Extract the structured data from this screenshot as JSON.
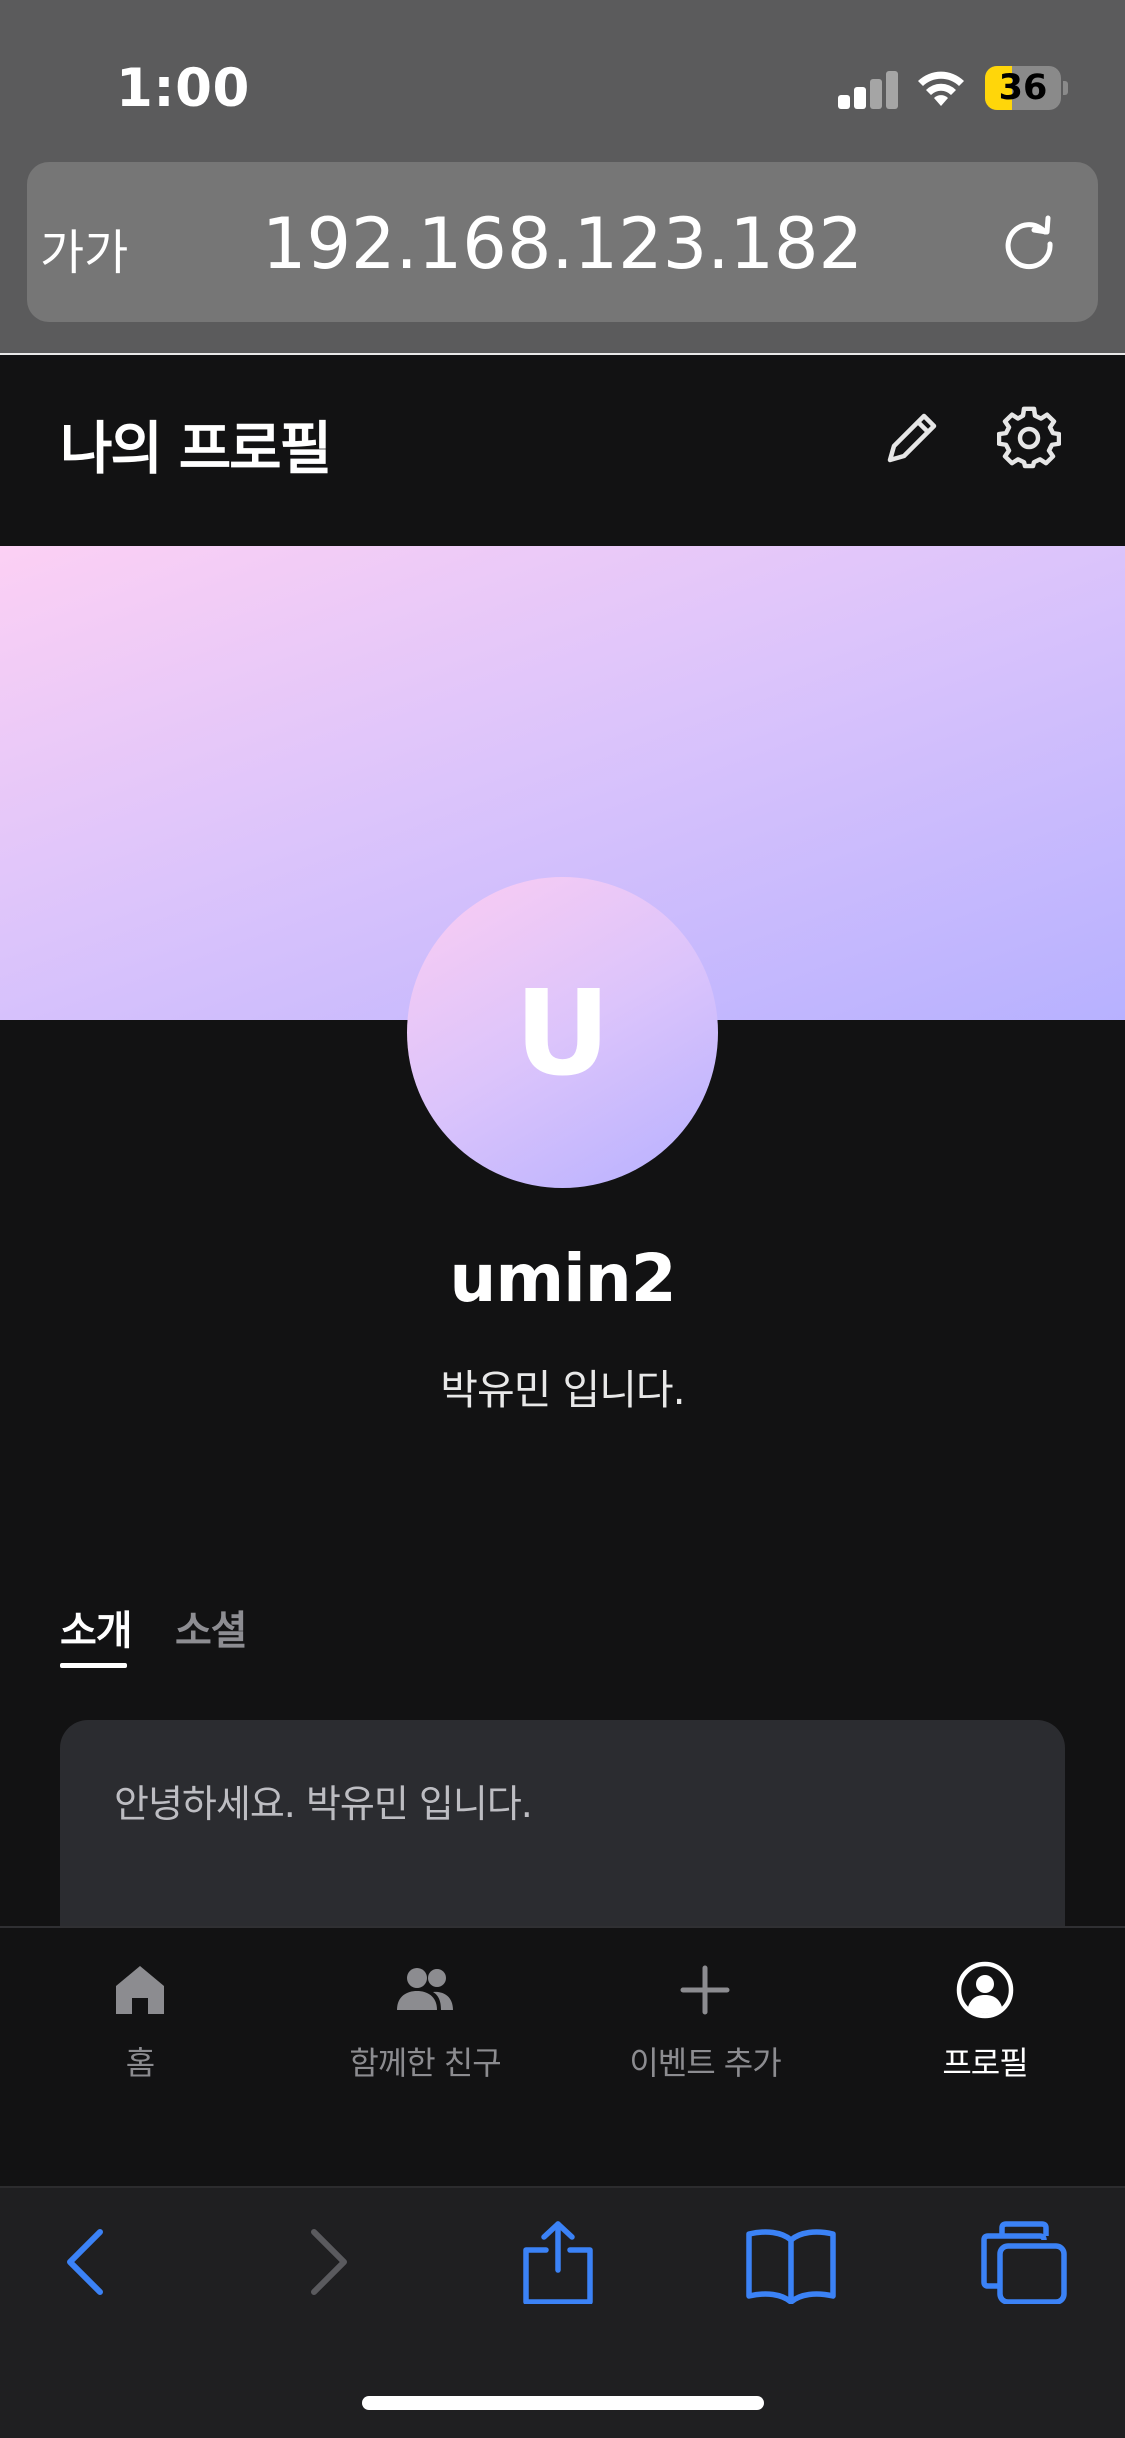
{
  "status_bar": {
    "time": "1:00",
    "battery_level": "36",
    "battery_fraction": 0.36,
    "battery_color": "#ffd60a"
  },
  "browser": {
    "text_size_label": "가가",
    "url": "192.168.123.182",
    "reload_icon": "reload-icon",
    "toolbar_icons": [
      "back-icon",
      "forward-icon",
      "share-icon",
      "bookmarks-icon",
      "tabs-icon"
    ],
    "accent_color": "#3b82f6"
  },
  "header": {
    "title": "나의 프로필",
    "edit_icon": "pencil-icon",
    "settings_icon": "gear-icon"
  },
  "profile": {
    "avatar_initial": "U",
    "username": "umin2",
    "bio": "박유민 입니다.",
    "cover_colors": [
      "#fcd0f4",
      "#dcc4fb",
      "#b7b1ff"
    ]
  },
  "tabs": [
    {
      "label": "소개",
      "active": true
    },
    {
      "label": "소셜",
      "active": false
    }
  ],
  "intro": {
    "text": "안녕하세요. 박유민 입니다."
  },
  "bottom_nav": [
    {
      "label": "홈",
      "icon": "home-icon",
      "active": false
    },
    {
      "label": "함께한 친구",
      "icon": "friends-icon",
      "active": false
    },
    {
      "label": "이벤트 추가",
      "icon": "plus-icon",
      "active": false
    },
    {
      "label": "프로필",
      "icon": "profile-icon",
      "active": true
    }
  ]
}
